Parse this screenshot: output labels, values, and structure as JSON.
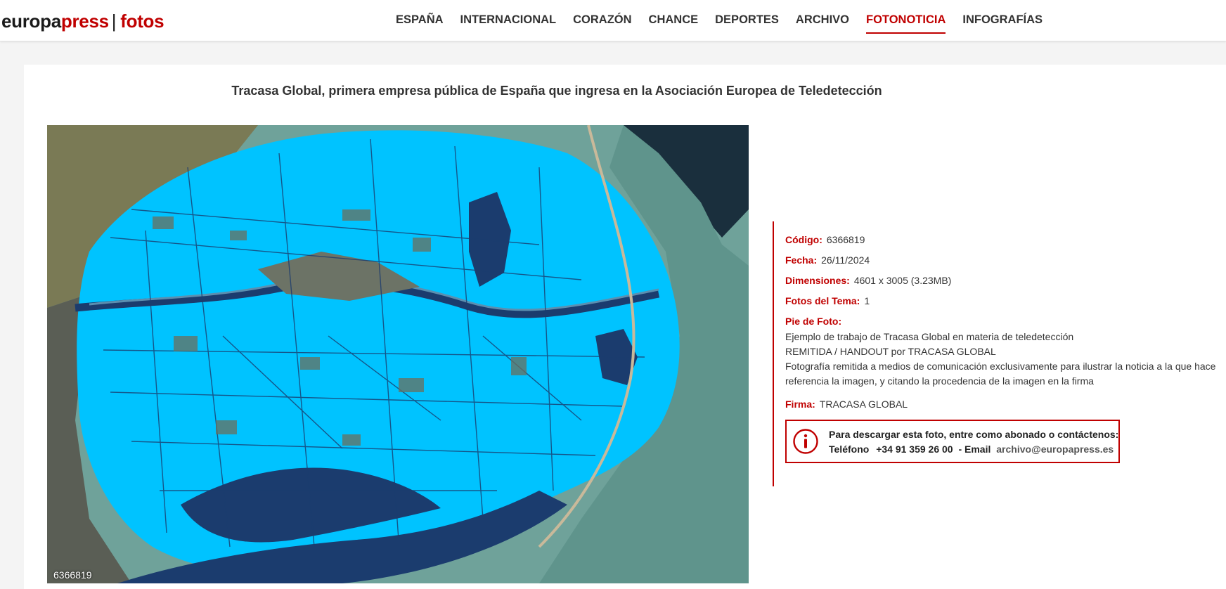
{
  "brand": {
    "part1": "europa",
    "part2": "press",
    "separator": "|",
    "part3": "fotos"
  },
  "nav": [
    {
      "label": "ESPAÑA"
    },
    {
      "label": "INTERNACIONAL"
    },
    {
      "label": "CORAZÓN"
    },
    {
      "label": "CHANCE"
    },
    {
      "label": "DEPORTES"
    },
    {
      "label": "ARCHIVO"
    },
    {
      "label": "FOTONOTICIA",
      "active": true
    },
    {
      "label": "INFOGRAFÍAS"
    }
  ],
  "article": {
    "title": "Tracasa Global, primera empresa pública de España que ingresa en la Asociación Europea de Teledetección",
    "photo_code_overlay": "6366819"
  },
  "info": {
    "codigo_label": "Código:",
    "codigo": "6366819",
    "fecha_label": "Fecha:",
    "fecha": "26/11/2024",
    "dimensiones_label": "Dimensiones:",
    "dimensiones": "4601 x 3005 (3.23MB)",
    "fotos_tema_label": "Fotos del Tema:",
    "fotos_tema": "1",
    "pie_label": "Pie de Foto:",
    "pie_line1": "Ejemplo de trabajo de Tracasa Global en materia de teledetección",
    "pie_line2": "REMITIDA / HANDOUT por TRACASA GLOBAL",
    "pie_line3": "Fotografía remitida a medios de comunicación exclusivamente para ilustrar la noticia a la que hace referencia la imagen, y citando la procedencia de la imagen en la firma",
    "firma_label": "Firma:",
    "firma": "TRACASA GLOBAL"
  },
  "download": {
    "line1": "Para descargar esta foto, entre como abonado o contáctenos:",
    "phone_label": "Teléfono",
    "phone": "+34 91 359 26 00",
    "email_label": "- Email",
    "email": "archivo@europapress.es"
  },
  "colors": {
    "accent": "#c00000",
    "flood": "#00c3ff",
    "water": "#1b3c6e",
    "sea": "#6fa29a"
  },
  "icons": {
    "info": "info-circle-icon"
  }
}
